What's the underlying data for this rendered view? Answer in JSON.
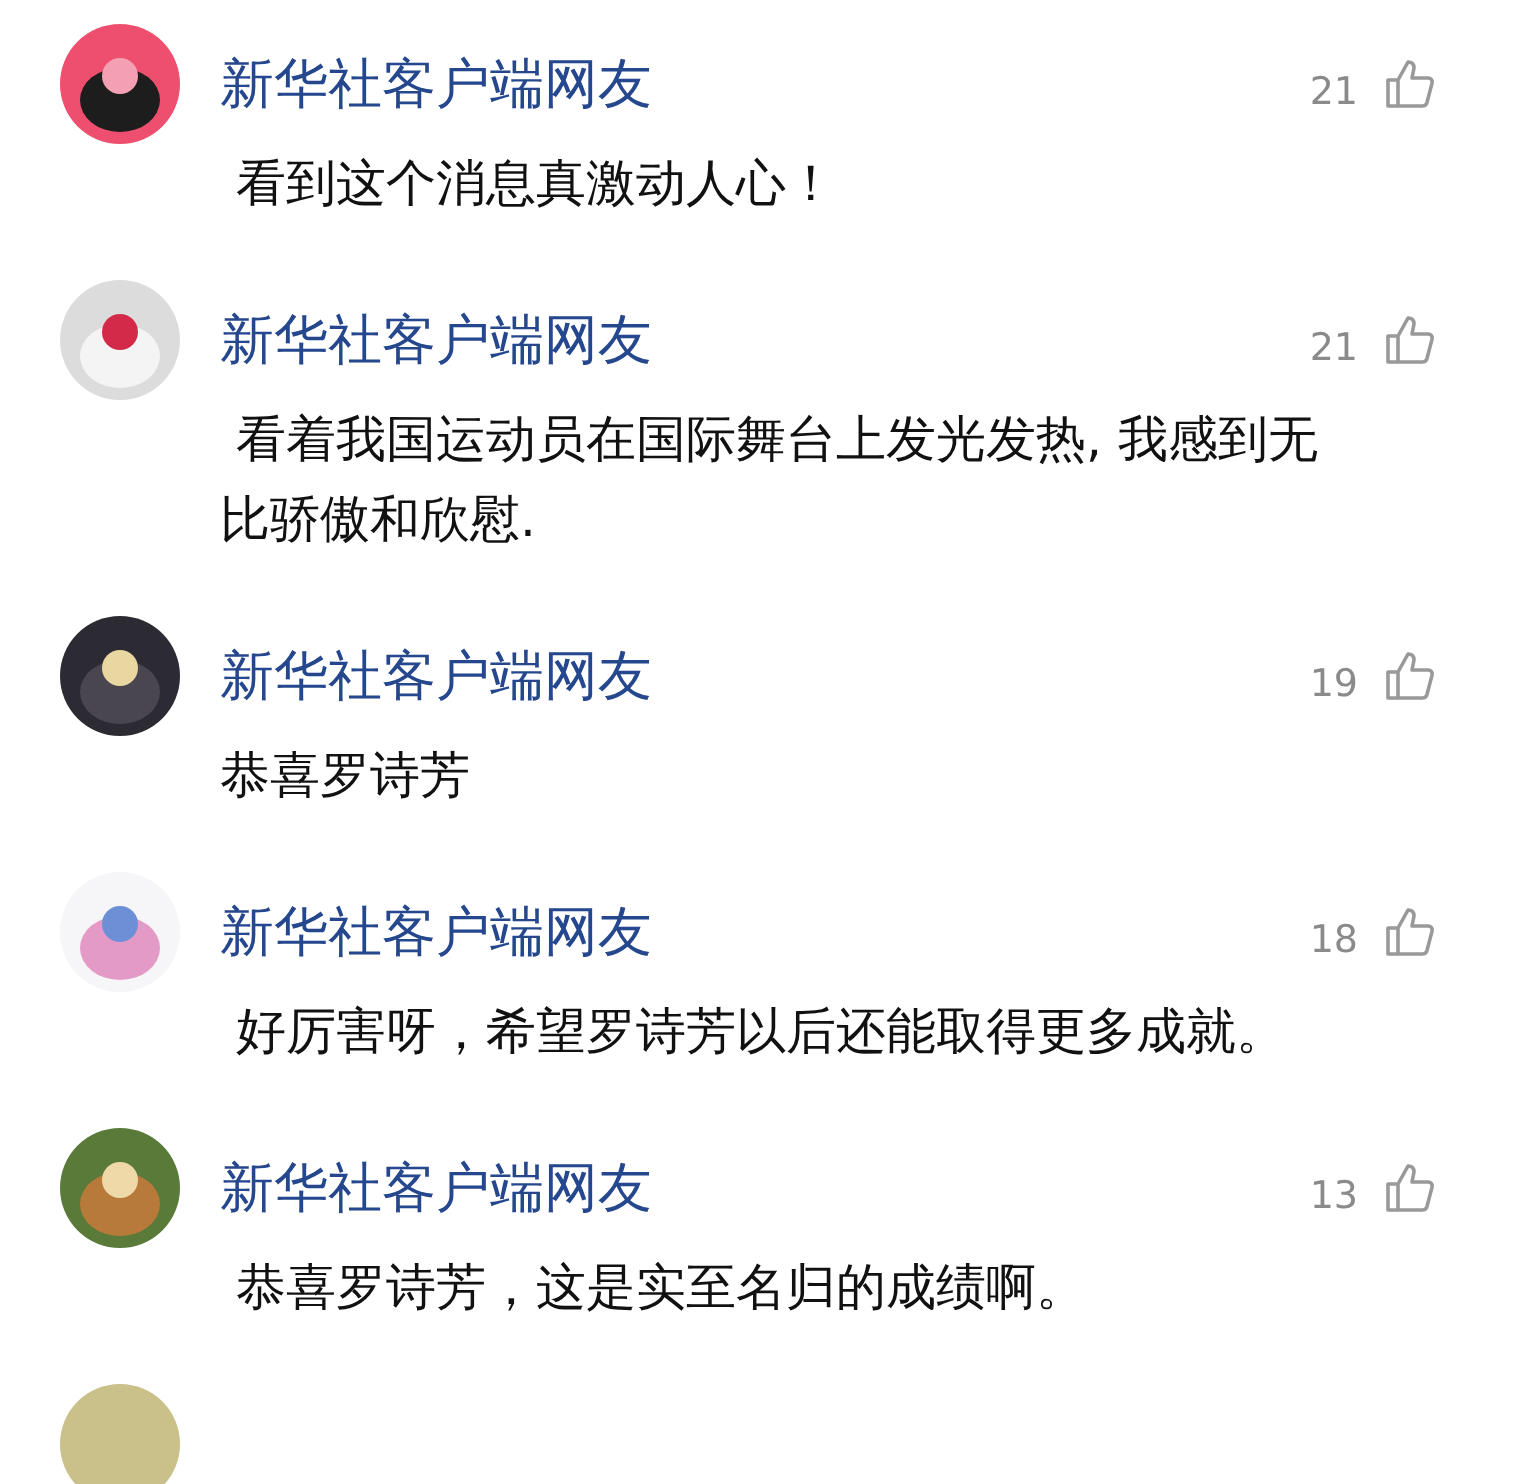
{
  "comments": [
    {
      "author": "新华社客户端网友",
      "likes": "21",
      "text": " 看到这个消息真激动人心！"
    },
    {
      "author": "新华社客户端网友",
      "likes": "21",
      "text": " 看着我国运动员在国际舞台上发光发热, 我感到无比骄傲和欣慰."
    },
    {
      "author": "新华社客户端网友",
      "likes": "19",
      "text": "恭喜罗诗芳"
    },
    {
      "author": "新华社客户端网友",
      "likes": "18",
      "text": " 好厉害呀，希望罗诗芳以后还能取得更多成就。"
    },
    {
      "author": "新华社客户端网友",
      "likes": "13",
      "text": " 恭喜罗诗芳，这是实至名归的成绩啊。"
    }
  ]
}
